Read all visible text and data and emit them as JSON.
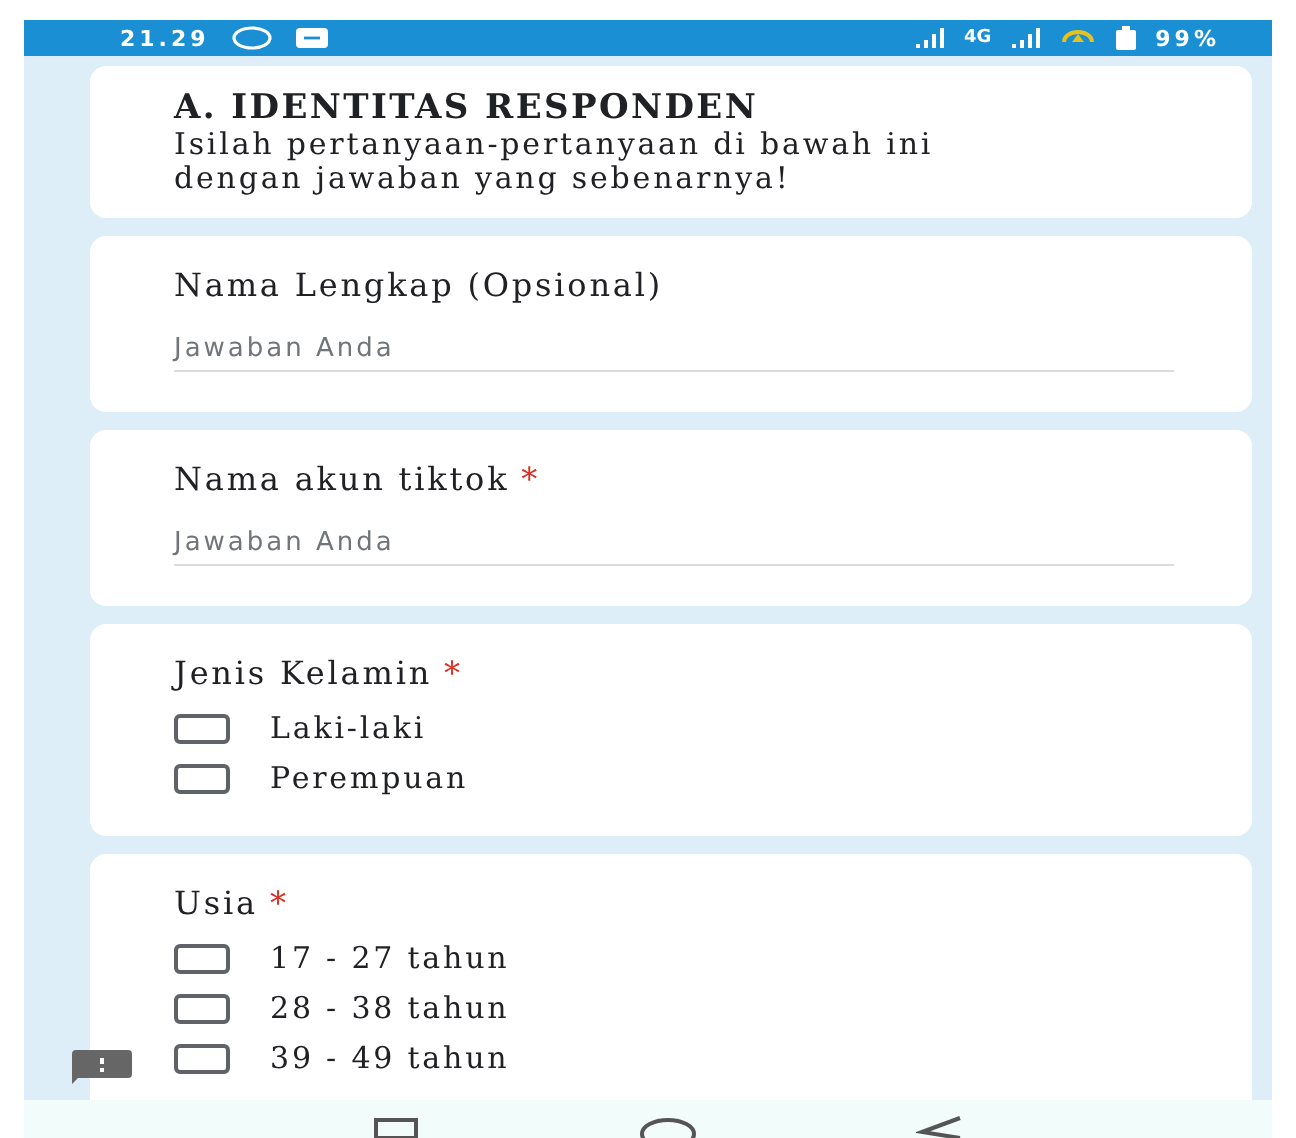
{
  "status_bar": {
    "time": "21.29",
    "network": "4G",
    "battery": "99%"
  },
  "section": {
    "title": "A. IDENTITAS RESPONDEN",
    "description": "Isilah pertanyaan-pertanyaan di bawah ini dengan jawaban yang sebenarnya!"
  },
  "questions": [
    {
      "kind": "text",
      "label": "Nama Lengkap (Opsional)",
      "placeholder": "Jawaban Anda"
    },
    {
      "kind": "text",
      "label": "Nama akun tiktok",
      "required_mark": "*",
      "placeholder": "Jawaban Anda"
    },
    {
      "kind": "checkbox",
      "label": "Jenis Kelamin",
      "required_mark": "*",
      "options": [
        {
          "label": "Laki-laki",
          "checked": false
        },
        {
          "label": "Perempuan",
          "checked": false
        }
      ]
    },
    {
      "kind": "checkbox",
      "label": "Usia",
      "required_mark": "*",
      "options": [
        {
          "label": "17 - 27 tahun",
          "checked": false
        },
        {
          "label": "28 - 38 tahun",
          "checked": false
        },
        {
          "label": "39 - 49 tahun",
          "checked": false
        }
      ]
    }
  ]
}
